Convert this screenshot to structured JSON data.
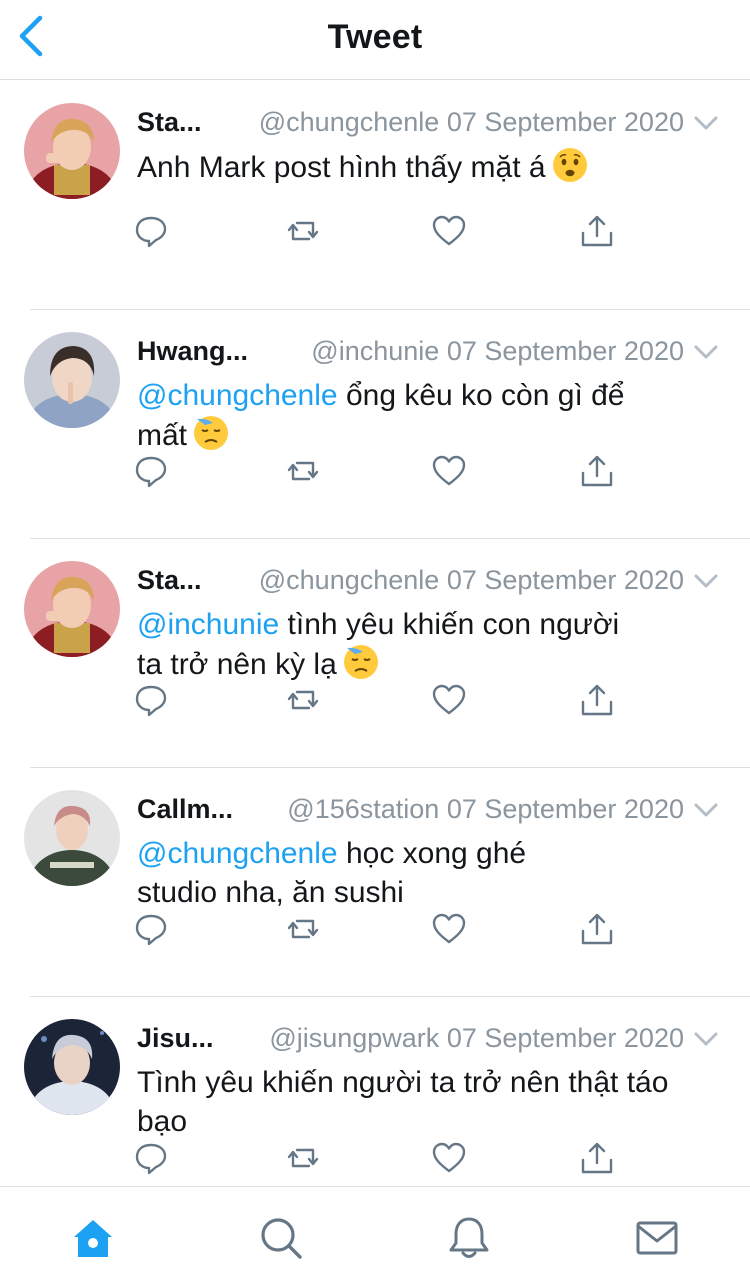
{
  "header": {
    "title": "Tweet",
    "back_icon": "chevron-left-icon"
  },
  "colors": {
    "accent": "#1da1f2",
    "muted": "#8a959e",
    "icon": "#657786",
    "divider": "#dcdfe3"
  },
  "tweets": [
    {
      "name": "Sta...",
      "handle": "@chungchenle",
      "date": "07 September 2020",
      "mention": "",
      "text": "Anh Mark post hình thấy mặt á",
      "text2": "",
      "emoji": "worried-face",
      "avatar": "avatar-red"
    },
    {
      "name": "Hwang...",
      "handle": "@inchunie",
      "date": "07 September 2020",
      "mention": "@chungchenle",
      "text": " ổng kêu ko còn gì để",
      "text2": "mất",
      "emoji": "downcast-sweat-face",
      "avatar": "avatar-blue"
    },
    {
      "name": "Sta...",
      "handle": "@chungchenle",
      "date": "07 September 2020",
      "mention": "@inchunie",
      "text": " tình yêu khiến con người",
      "text2": "ta trở nên kỳ lạ",
      "emoji": "downcast-sweat-face",
      "avatar": "avatar-red"
    },
    {
      "name": "Callm...",
      "handle": "@156station",
      "date": "07 September 2020",
      "mention": "@chungchenle",
      "text": " học xong ghé",
      "text2": "studio nha, ăn sushi",
      "emoji": "",
      "avatar": "avatar-grey"
    },
    {
      "name": "Jisu...",
      "handle": "@jisungpwark",
      "date": "07 September 2020",
      "mention": "",
      "text": "Tình yêu khiến người ta trở nên thật táo",
      "text2": "bạo",
      "emoji": "",
      "avatar": "avatar-dark"
    }
  ],
  "tabbar": {
    "items": [
      {
        "icon": "home-icon",
        "active": true
      },
      {
        "icon": "search-icon",
        "active": false
      },
      {
        "icon": "bell-icon",
        "active": false
      },
      {
        "icon": "mail-icon",
        "active": false
      }
    ]
  }
}
